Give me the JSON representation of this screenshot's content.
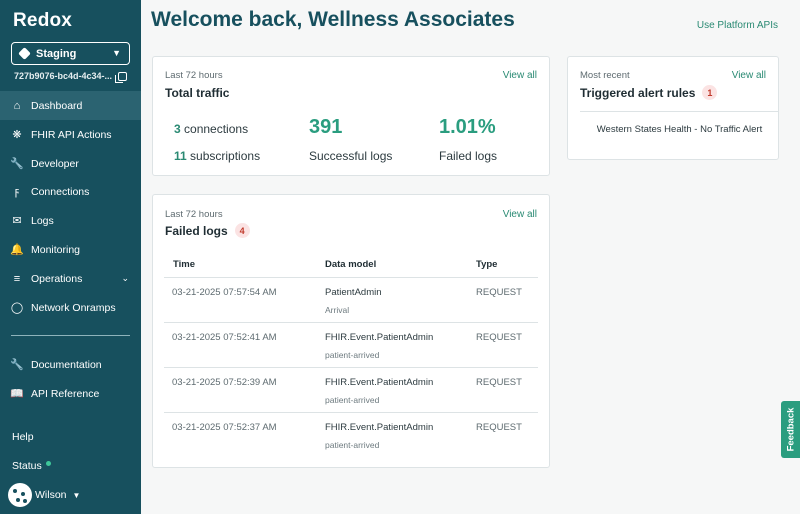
{
  "app": {
    "logo": "Redox"
  },
  "sidebar": {
    "environment": {
      "name": "Staging",
      "id": "727b9076-bc4d-4c34-..."
    },
    "nav": [
      {
        "label": "Dashboard",
        "icon": "home-icon"
      },
      {
        "label": "FHIR API Actions",
        "icon": "fhir-icon"
      },
      {
        "label": "Developer",
        "icon": "wrench-icon"
      },
      {
        "label": "Connections",
        "icon": "connections-icon"
      },
      {
        "label": "Logs",
        "icon": "mail-icon"
      },
      {
        "label": "Monitoring",
        "icon": "bell-icon"
      },
      {
        "label": "Operations",
        "icon": "sliders-icon"
      },
      {
        "label": "Network Onramps",
        "icon": "globe-icon"
      }
    ],
    "docs": [
      {
        "label": "Documentation",
        "icon": "wrench-icon"
      },
      {
        "label": "API Reference",
        "icon": "book-icon"
      }
    ],
    "help": "Help",
    "status": "Status",
    "user": "Wilson"
  },
  "header": {
    "title": "Welcome back, Wellness Associates",
    "platform_link": "Use Platform APIs"
  },
  "traffic": {
    "caption": "Last 72 hours",
    "title": "Total traffic",
    "view_all": "View all",
    "connections_count": "3",
    "connections_label": "connections",
    "subscriptions_count": "11",
    "subscriptions_label": "subscriptions",
    "successful_value": "391",
    "successful_label": "Successful logs",
    "failed_value": "1.01%",
    "failed_label": "Failed logs"
  },
  "alerts": {
    "caption": "Most recent",
    "title": "Triggered alert rules",
    "count": "1",
    "view_all": "View all",
    "items": [
      "Western States Health - No Traffic Alert"
    ]
  },
  "failed_logs": {
    "caption": "Last 72 hours",
    "title": "Failed logs",
    "count": "4",
    "view_all": "View all",
    "columns": [
      "Time",
      "Data model",
      "Type"
    ],
    "rows": [
      {
        "time": "03-21-2025 07:57:54 AM",
        "model": "PatientAdmin",
        "sub": "Arrival",
        "type": "REQUEST"
      },
      {
        "time": "03-21-2025 07:52:41 AM",
        "model": "FHIR.Event.PatientAdmin",
        "sub": "patient-arrived",
        "type": "REQUEST"
      },
      {
        "time": "03-21-2025 07:52:39 AM",
        "model": "FHIR.Event.PatientAdmin",
        "sub": "patient-arrived",
        "type": "REQUEST"
      },
      {
        "time": "03-21-2025 07:52:37 AM",
        "model": "FHIR.Event.PatientAdmin",
        "sub": "patient-arrived",
        "type": "REQUEST"
      }
    ]
  },
  "feedback": "Feedback",
  "colors": {
    "sidebar": "#17505e",
    "accent": "#2a9d7f",
    "link": "#2a8a73",
    "badge": "#c0392b"
  }
}
